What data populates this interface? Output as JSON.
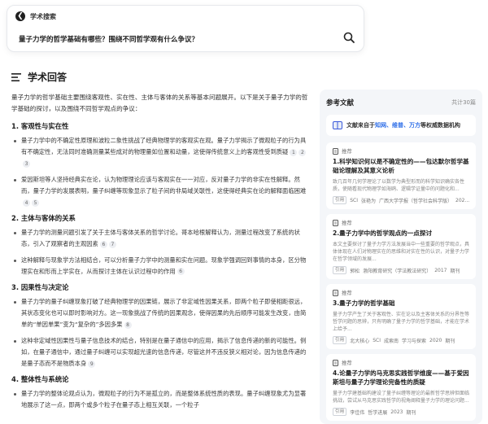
{
  "search": {
    "title": "学术搜索",
    "query": "量子力学的哲学基础有哪些？围绕不同哲学观有什么争议？"
  },
  "answer": {
    "title": "学术回答",
    "intro": "量子力学的哲学基础主要围绕客观性、实在性、主体与客体的关系等基本问题展开。以下是关于量子力学的哲学基础的探讨，以及围绕不同哲学观点的争议：",
    "sections": [
      {
        "heading": "1. 客观性与实在性",
        "bullets": [
          {
            "text": "量子力学中的不确定性原理和波粒二象性挑战了经典物理学的客观实在观。量子力学揭示了微观粒子的行为具有不确定性，无法同时准确测量某些成对的物理量如位置和动量，这使得传统意义上的客观性受到质疑",
            "cites": [
              "1",
              "2",
              "3"
            ]
          },
          {
            "text": "爱因斯坦等人坚持经典实在论，认为物理理论应该与客观实在一一对应，反对量子力学的非实在性解释。然而，量子力学的发展表明，量子纠缠等现象显示了粒子间的非局域关联性，这使得经典实在论的解释面临困难",
            "cites": [
              "4",
              "5"
            ]
          }
        ]
      },
      {
        "heading": "2. 主体与客体的关系",
        "bullets": [
          {
            "text": "量子力学的测量问题引发了关于主体与客体关系的哲学讨论。哥本哈根解释认为，测量过程改变了系统的状态，引入了观察者的主观因素",
            "cites": [
              "6",
              "7"
            ]
          },
          {
            "text": "这种解释与现象学方法相结合，可以分析量子力学中的测量和实在问题。现象学强调回到事情的本身，区分物理实在和形而上学实在，从而探讨主体在认识过程中的作用",
            "cites": [
              "6"
            ]
          }
        ]
      },
      {
        "heading": "3. 因果性与决定论",
        "bullets": [
          {
            "text": "量子力学的量子纠缠现象打破了经典物理学的因果链，展示了非定域性因果关系，即两个粒子即使相距很远，其状态变化也可以即时影响对方。这一现象挑战了传统的因果观念，使得因果的先后顺序可能发生改变，由简单的“单因单果”变为“复杂的”多因多果",
            "cites": [
              "8"
            ]
          },
          {
            "text": "这种非定域性因果性与量子信息技术的结合，特别是在量子通信中的应用，揭示了信息传递的新的可能性。例如，在量子通信中，通过量子纠缠可以实现超光速的信息传递，尽管这并不违反狭义相对论，因为信息传递的是量子态而不是物质本身",
            "cites": [
              "9"
            ]
          }
        ]
      },
      {
        "heading": "4. 整体性与系统论",
        "bullets": [
          {
            "text": "量子力学的整体论观点认为，微观粒子的行为不是孤立的，而是整体系统性质的表现。量子纠缠现象尤为显著地展示了这一点，即两个或多个粒子在量子态上相互关联，一个粒子",
            "cites": []
          }
        ]
      }
    ]
  },
  "references": {
    "title": "参考文献",
    "count": "共计30篇",
    "source_note_prefix": "文献来自于",
    "source_names": "知网、维普、万方",
    "source_note_suffix": "等权威数据机构",
    "items": [
      {
        "label": "推荐",
        "title": "1.科学知识何以是不确定性的——包达默尔哲学基础论理解及其意义论析",
        "abstract": "致几百年几何学理论了以数学为典型形而的科学知识确实各性质，使随看现代物理学如海鸥、逻辑学证量中的问题化和...",
        "meta": [
          "引用",
          "SCI",
          "张艳为",
          "广西大学学报（哲学社会科学版）",
          "202..."
        ]
      },
      {
        "label": "推荐",
        "title": "2.量子力学中的哲学观点的一点探讨",
        "abstract": "本文主要探讨了量子力学方法发展当中一些重要的哲学观点，具体体现在人们对物理实在的思维和对实在性的认识，对量子力学在哲学领域的发展...",
        "meta": [
          "引用",
          "郭松",
          "渤阳教育研究（学法教法研究）",
          "2017",
          "期刊"
        ]
      },
      {
        "label": "推荐",
        "title": "3.量子力学的哲学基础",
        "abstract": "量子力学产生了关于客观性、实在论以及主客体关系的分界性等哲学问题的思辨，只有明确了量子力学的哲学基础，才能在学术上给予...",
        "meta": [
          "引用",
          "北大核心",
          "SCI",
          "成索南",
          "学习与探索",
          "2020",
          "期刊"
        ]
      },
      {
        "label": "推荐",
        "title": "4.论量子力学的马克思实践哲学维度——基于爱因斯坦与量子力学理论完备性的质疑",
        "abstract": "量子力学建基础构建设了量子纠缠等理论的最新哲学思辨但面临挑战，尝试从马克思实践哲学的视角阐释量子力学的理论问题...",
        "meta": [
          "引用",
          "李佳伟",
          "哲学进展",
          "2023",
          "期刊"
        ]
      }
    ]
  }
}
